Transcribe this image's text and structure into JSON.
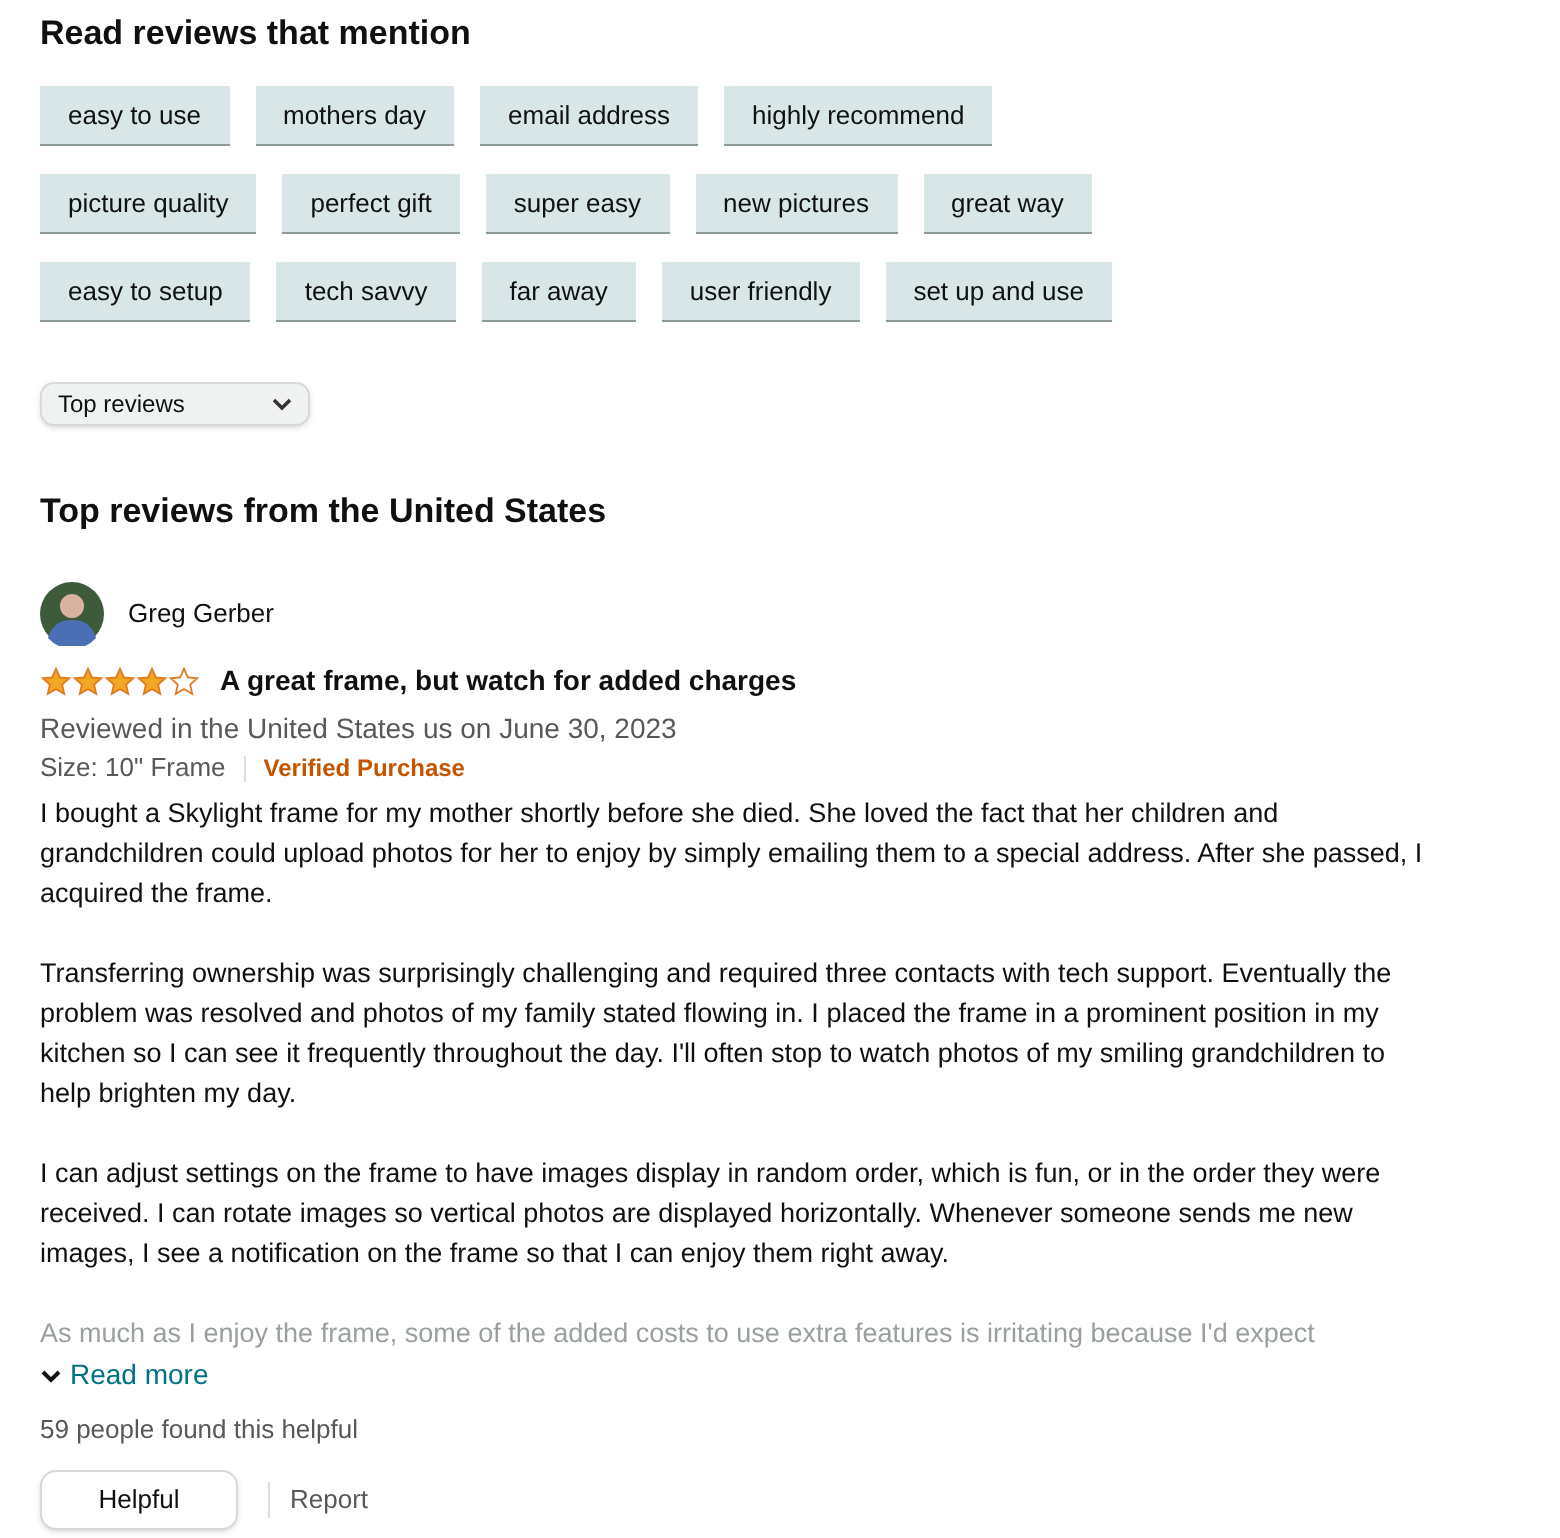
{
  "mentions": {
    "title": "Read reviews that mention",
    "rows": [
      [
        "easy to use",
        "mothers day",
        "email address",
        "highly recommend"
      ],
      [
        "picture quality",
        "perfect gift",
        "super easy",
        "new pictures",
        "great way"
      ],
      [
        "easy to setup",
        "tech savvy",
        "far away",
        "user friendly",
        "set up and use"
      ]
    ]
  },
  "sort": {
    "value": "Top reviews"
  },
  "reviews_section": {
    "title": "Top reviews from the United States"
  },
  "review": {
    "author": "Greg Gerber",
    "stars": 4,
    "title": "A great frame, but watch for added charges",
    "meta": "Reviewed in the United States us on June 30, 2023",
    "variant": "Size: 10\" Frame",
    "verified": "Verified Purchase",
    "paragraphs": [
      "I bought a Skylight frame for my mother shortly before she died. She loved the fact that her children and grandchildren could upload photos for her to enjoy by simply emailing them to a special address. After she passed, I acquired the frame.",
      "Transferring ownership was surprisingly challenging and required three contacts with tech support. Eventually the problem was resolved and photos of my family stated flowing in. I placed the frame in a prominent position in my kitchen so I can see it frequently throughout the day. I'll often stop to watch photos of my smiling grandchildren to help brighten my day.",
      "I can adjust settings on the frame to have images display in random order, which is fun, or in the order they were received. I can rotate images so vertical photos are displayed horizontally. Whenever someone sends me new images, I see a notification on the frame so that I can enjoy them right away.",
      "As much as I enjoy the frame, some of the added costs to use extra features is irritating because I'd expect"
    ],
    "read_more": "Read more",
    "helpful_count": "59 people found this helpful",
    "helpful_button": "Helpful",
    "report": "Report"
  }
}
